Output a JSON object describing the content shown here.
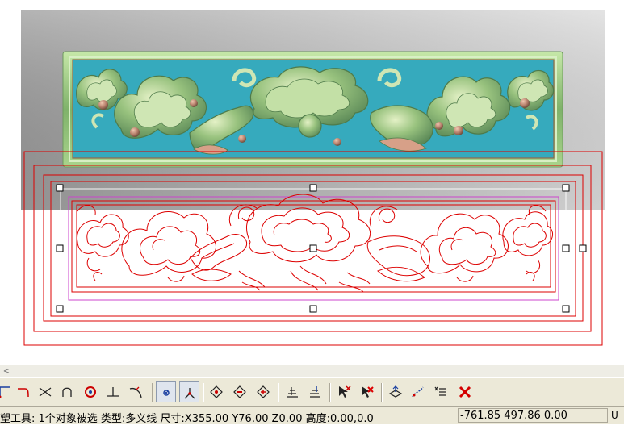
{
  "status": {
    "message": "塑工具: 1个对象被选 类型:多义线 尺寸:X355.00 Y76.00 Z0.00 高度:0.00,0.0",
    "coords": "-761.85 497.86 0.00",
    "mode": "U"
  },
  "scrollbar": {
    "left_arrow": "<"
  },
  "toolbar": {
    "buttons": [
      "curve-arc-icon",
      "corner-icon",
      "trim-cross-icon",
      "arc-connect-icon",
      "circle-offset-icon",
      "perpendicular-icon",
      "extend-curve-icon",
      "node-select-icon",
      "node-branch-icon",
      "diamond-transform-1-icon",
      "diamond-transform-2-icon",
      "diamond-transform-3-icon",
      "align-bottom-icon",
      "align-grid-icon",
      "arrow-delete-icon",
      "arrow-delete-red-icon",
      "3d-arrow-icon",
      "curve-arrow-icon",
      "list-check-icon",
      "delete-x-icon"
    ]
  },
  "colors": {
    "relief_teal": "#3aaec0",
    "relief_green": "#8cc07a",
    "outline_red": "#dd0000",
    "selection_magenta": "#cc44cc",
    "grey_backdrop": "#a9a9a9"
  }
}
